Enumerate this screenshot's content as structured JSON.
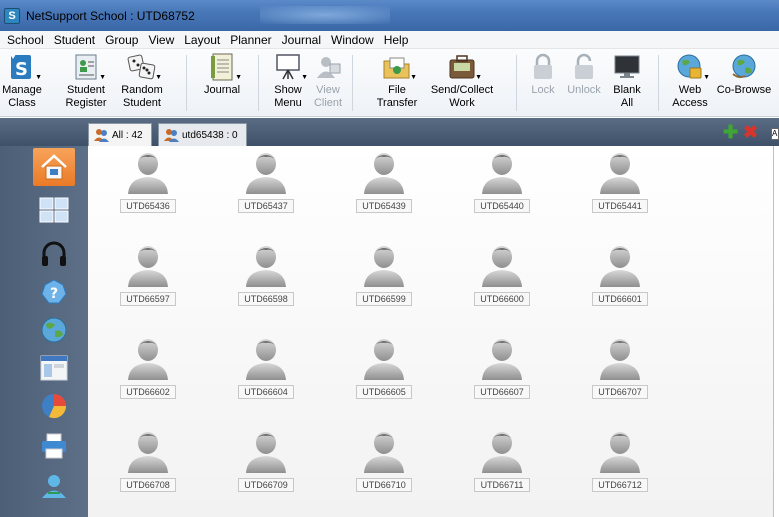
{
  "window": {
    "title": "NetSupport School : UTD68752"
  },
  "menu": [
    "School",
    "Student",
    "Group",
    "View",
    "Layout",
    "Planner",
    "Journal",
    "Window",
    "Help"
  ],
  "toolbar": {
    "manage_class": "Manage\nClass",
    "student_register": "Student\nRegister",
    "random_student": "Random\nStudent",
    "journal": "Journal",
    "show_menu": "Show\nMenu",
    "view_client": "View\nClient",
    "file_transfer": "File\nTransfer",
    "send_collect": "Send/Collect\nWork",
    "lock": "Lock",
    "unlock": "Unlock",
    "blank_all": "Blank\nAll",
    "web_access": "Web\nAccess",
    "co_browse": "Co-Browse"
  },
  "tabs": [
    {
      "label": "All : 42"
    },
    {
      "label": "utd65438 : 0"
    }
  ],
  "strip": {
    "edge_glyph": "A"
  },
  "students": [
    "UTD65436",
    "UTD65437",
    "UTD65439",
    "UTD65440",
    "UTD65441",
    "UTD66597",
    "UTD66598",
    "UTD66599",
    "UTD66600",
    "UTD66601",
    "UTD66602",
    "UTD66604",
    "UTD66605",
    "UTD66607",
    "UTD66707",
    "UTD66708",
    "UTD66709",
    "UTD66710",
    "UTD66711",
    "UTD66712"
  ],
  "colors": {
    "title_bar": "#4877b8",
    "sidebar": "#55677f",
    "active_sidebar": "#ef8a35",
    "tab_strip": "#4b5d74"
  },
  "sidebar_icons": [
    "home-icon",
    "layout-icon",
    "headphones-icon",
    "help-icon",
    "globe-icon",
    "window-icon",
    "pie-chart-icon",
    "printer-icon",
    "user-icon"
  ]
}
